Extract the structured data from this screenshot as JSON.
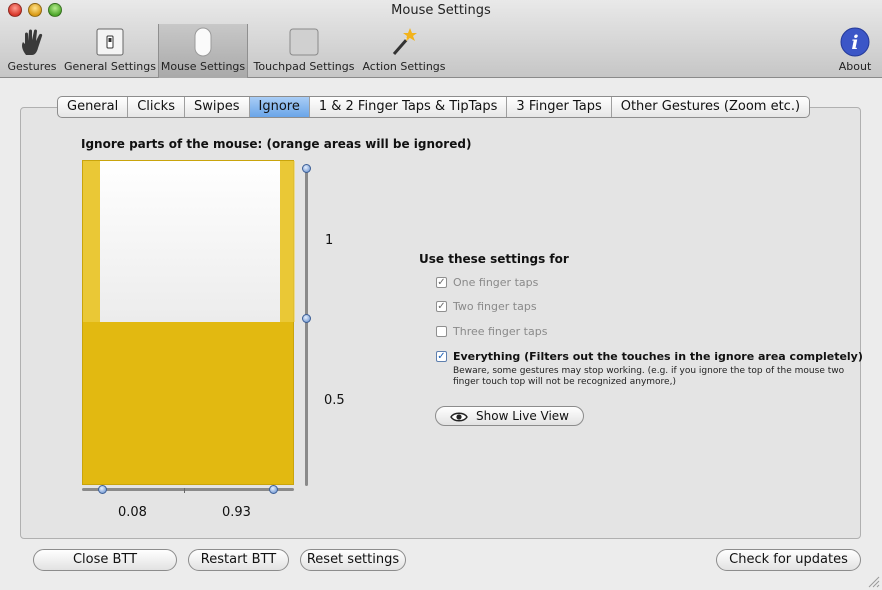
{
  "window": {
    "title": "Mouse Settings"
  },
  "toolbar": {
    "items": [
      {
        "label": "Gestures",
        "icon": "hand-icon"
      },
      {
        "label": "General Settings",
        "icon": "switch-icon"
      },
      {
        "label": "Mouse Settings",
        "icon": "magic-mouse-icon"
      },
      {
        "label": "Touchpad Settings",
        "icon": "trackpad-icon"
      },
      {
        "label": "Action Settings",
        "icon": "magic-wand-icon"
      }
    ],
    "about_label": "About"
  },
  "tabs": [
    "General",
    "Clicks",
    "Swipes",
    "Ignore",
    "1 & 2 Finger Taps & TipTaps",
    "3 Finger Taps",
    "Other Gestures (Zoom etc.)"
  ],
  "active_tab": "Ignore",
  "ignore": {
    "heading": "Ignore parts of the mouse: (orange areas will be ignored)",
    "vertical_labels": {
      "top": "1",
      "middle": "0.5"
    },
    "left_value": "0.08",
    "right_value": "0.93",
    "top_value_fraction": 0.5,
    "ignore_color": "#e2b911"
  },
  "settings": {
    "heading": "Use these settings for",
    "options": [
      {
        "label": "One finger taps",
        "checked": true,
        "enabled": false
      },
      {
        "label": "Two finger taps",
        "checked": true,
        "enabled": false
      },
      {
        "label": "Three finger taps",
        "checked": false,
        "enabled": false
      },
      {
        "label": "Everything (Filters out the touches in the ignore area completely)",
        "checked": true,
        "enabled": true
      }
    ],
    "warning": "Beware, some gestures may stop working. (e.g. if you ignore the top of the mouse two finger touch top will not be recognized anymore,)",
    "live_view_label": "Show Live View"
  },
  "footer": {
    "close_label": "Close BTT",
    "restart_label": "Restart BTT",
    "reset_label": "Reset settings",
    "updates_label": "Check for updates"
  }
}
